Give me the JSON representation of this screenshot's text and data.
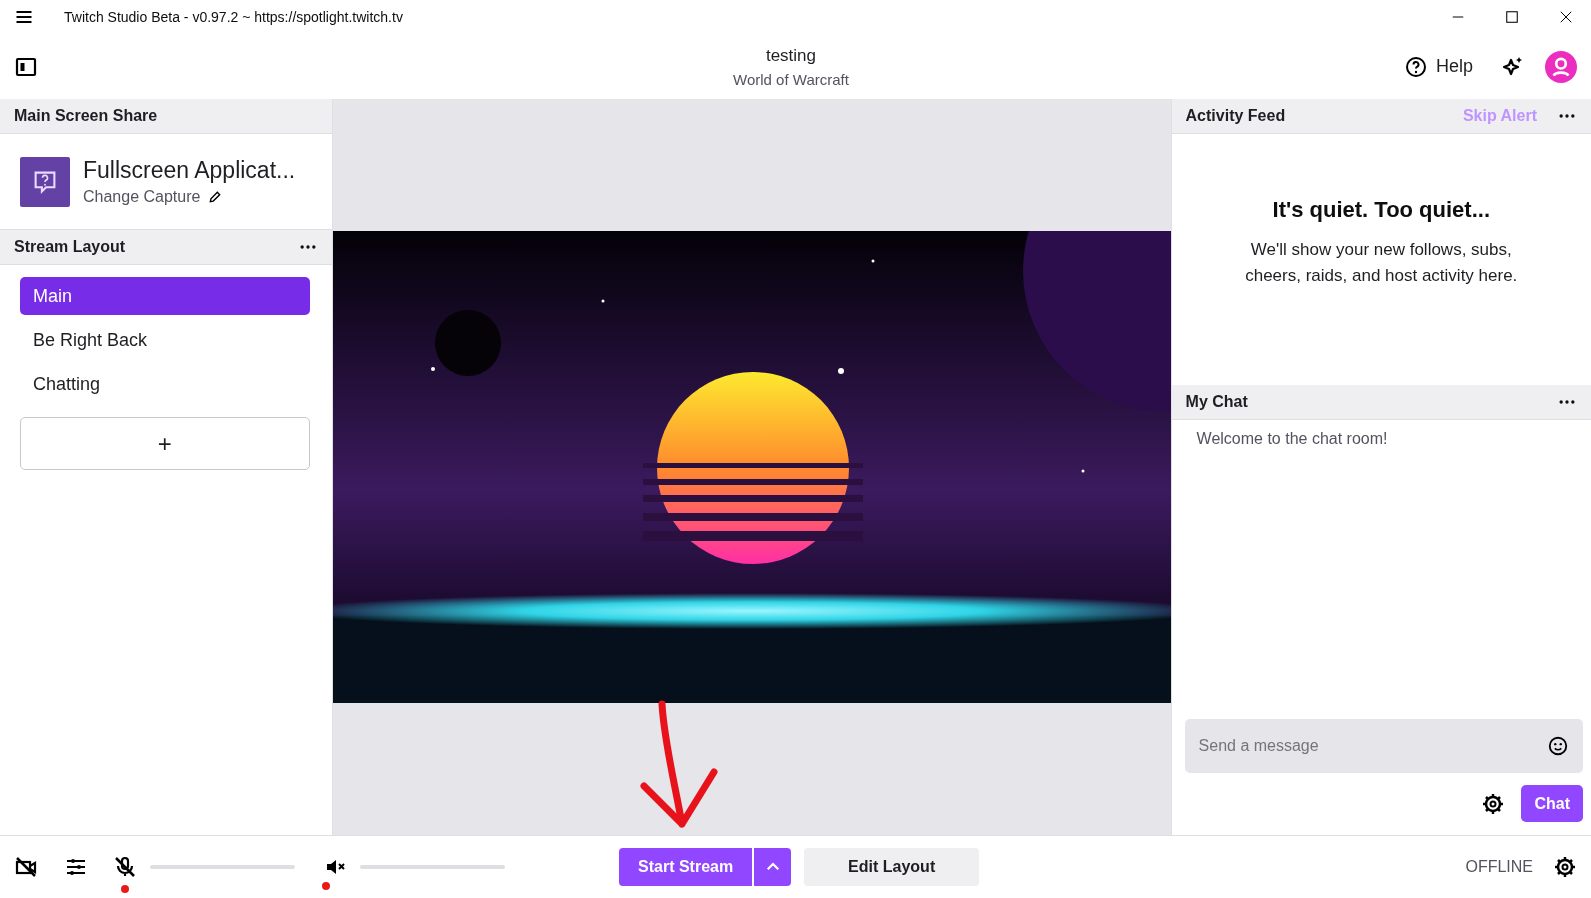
{
  "window": {
    "title": "Twitch Studio Beta - v0.97.2 ~ https://spotlight.twitch.tv"
  },
  "header": {
    "stream_title": "testing",
    "category": "World of Warcraft",
    "help": "Help"
  },
  "screen_share": {
    "heading": "Main Screen Share",
    "source_name": "Fullscreen Applicat...",
    "change_label": "Change Capture"
  },
  "stream_layout": {
    "heading": "Stream Layout",
    "add_label": "+",
    "items": [
      {
        "label": "Main",
        "selected": true
      },
      {
        "label": "Be Right Back",
        "selected": false
      },
      {
        "label": "Chatting",
        "selected": false
      }
    ]
  },
  "activity_feed": {
    "heading": "Activity Feed",
    "skip_alert": "Skip Alert",
    "empty_title": "It's quiet. Too quiet...",
    "empty_text": "We'll show your new follows, subs, cheers, raids, and host activity here."
  },
  "chat": {
    "heading": "My Chat",
    "welcome": "Welcome to the chat room!",
    "placeholder": "Send a message",
    "send_button": "Chat"
  },
  "bottom_bar": {
    "mic": {
      "muted": true,
      "level": 0
    },
    "speaker": {
      "muted": true,
      "level": 0
    },
    "start_button": "Start Stream",
    "edit_button": "Edit Layout",
    "status": "OFFLINE"
  }
}
